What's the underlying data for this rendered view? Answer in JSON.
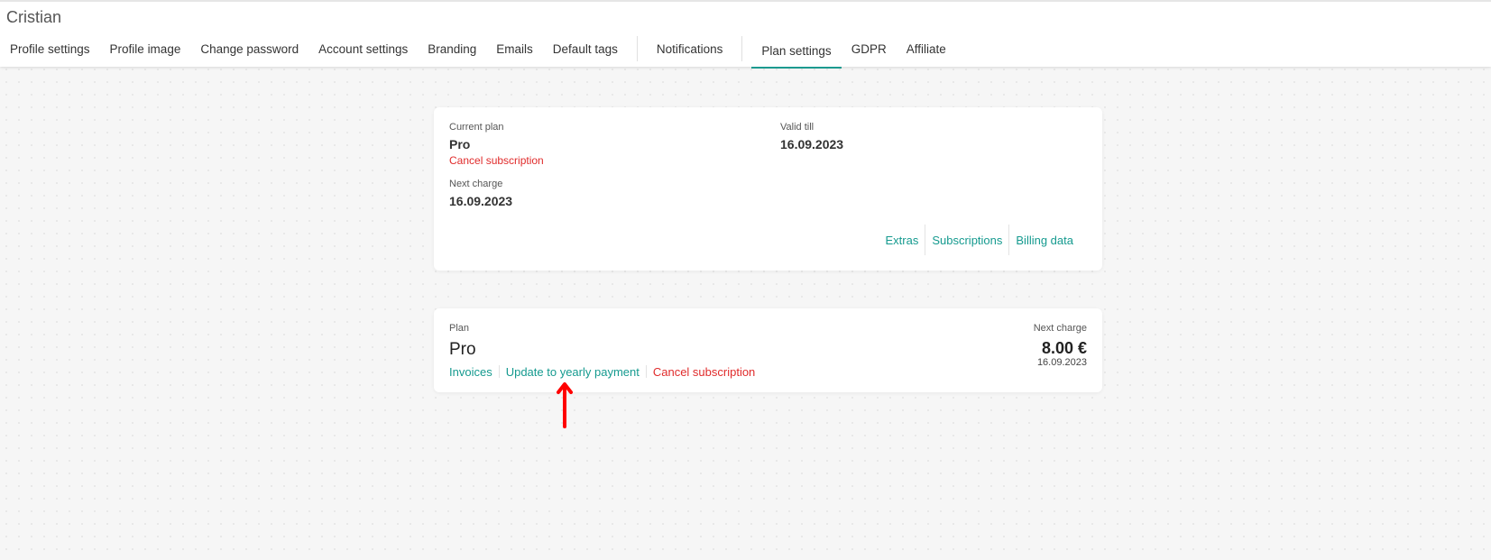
{
  "header": {
    "user_name": "Cristian",
    "tabs": [
      {
        "label": "Profile settings"
      },
      {
        "label": "Profile image"
      },
      {
        "label": "Change password"
      },
      {
        "label": "Account settings"
      },
      {
        "label": "Branding"
      },
      {
        "label": "Emails"
      },
      {
        "label": "Default tags"
      },
      {
        "label": "Notifications"
      },
      {
        "label": "Plan settings",
        "active": true
      },
      {
        "label": "GDPR"
      },
      {
        "label": "Affiliate"
      }
    ]
  },
  "current_plan_card": {
    "current_plan_label": "Current plan",
    "current_plan_value": "Pro",
    "cancel_link": "Cancel subscription",
    "valid_till_label": "Valid till",
    "valid_till_value": "16.09.2023",
    "next_charge_label": "Next charge",
    "next_charge_value": "16.09.2023",
    "links": {
      "extras": "Extras",
      "subscriptions": "Subscriptions",
      "billing_data": "Billing data"
    }
  },
  "plan_card": {
    "plan_label": "Plan",
    "plan_name": "Pro",
    "invoices_link": "Invoices",
    "update_link": "Update to yearly payment",
    "cancel_link": "Cancel subscription",
    "next_charge_label": "Next charge",
    "next_charge_amount": "8.00 €",
    "next_charge_date": "16.09.2023"
  },
  "colors": {
    "accent": "#159a8f",
    "danger": "#e02b2b",
    "annotation_arrow": "#ff0000"
  },
  "icons": {
    "annotation": "arrow-up-icon"
  }
}
